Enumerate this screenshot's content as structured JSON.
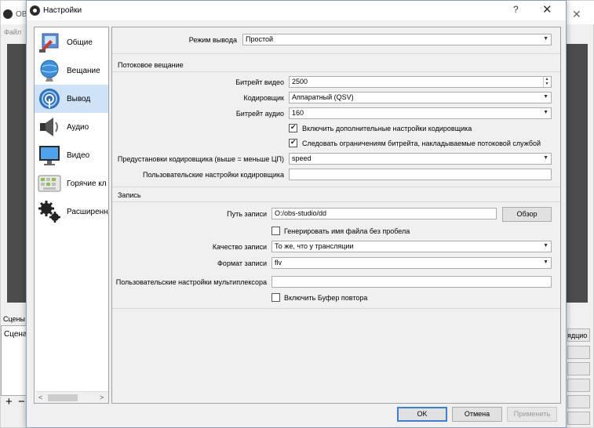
{
  "background_window": {
    "title": "OB",
    "menu_file": "Файл",
    "scenes_label": "Сцены",
    "scenes_item": "Сцена",
    "add_glyph": "+",
    "remove_glyph": "−",
    "right_button_text": "ядцио"
  },
  "dialog": {
    "title": "Настройки",
    "help_glyph": "?",
    "close_glyph": "✕"
  },
  "sidebar": {
    "items": [
      {
        "label": "Общие",
        "icon": "general-settings-icon",
        "selected": false
      },
      {
        "label": "Вещание",
        "icon": "broadcast-globe-icon",
        "selected": false
      },
      {
        "label": "Вывод",
        "icon": "output-signal-icon",
        "selected": true
      },
      {
        "label": "Аудио",
        "icon": "speaker-icon",
        "selected": false
      },
      {
        "label": "Видео",
        "icon": "monitor-icon",
        "selected": false
      },
      {
        "label": "Горячие кл",
        "icon": "keyboard-icon",
        "selected": false
      },
      {
        "label": "Расширенн",
        "icon": "gears-icon",
        "selected": false
      }
    ],
    "scroll_left": "<",
    "scroll_right": ">"
  },
  "output": {
    "mode_label": "Режим вывода",
    "mode_value": "Простой",
    "streaming": {
      "group_title": "Потоковое вещание",
      "video_bitrate_label": "Битрейт видео",
      "video_bitrate_value": "2500",
      "encoder_label": "Кодировщик",
      "encoder_value": "Аппаратный (QSV)",
      "audio_bitrate_label": "Битрейт аудио",
      "audio_bitrate_value": "160",
      "advanced_encoder_label": "Включить дополнительные настройки кодировщика",
      "advanced_encoder_checked": true,
      "enforce_bitrate_label": "Следовать ограничениям битрейта, накладываемые потоковой службой",
      "enforce_bitrate_checked": true,
      "preset_label": "Предустановки кодировщика (выше = меньше ЦП)",
      "preset_value": "speed",
      "custom_encoder_label": "Пользовательские настройки кодировщика",
      "custom_encoder_value": ""
    },
    "recording": {
      "group_title": "Запись",
      "path_label": "Путь записи",
      "path_value": "O:/obs-studio/dd",
      "browse_label": "Обзор",
      "no_space_label": "Генерировать имя файла без пробела",
      "no_space_checked": false,
      "quality_label": "Качество записи",
      "quality_value": "То же, что у трансляции",
      "format_label": "Формат записи",
      "format_value": "flv",
      "muxer_label": "Пользовательские настройки мультиплексора",
      "muxer_value": "",
      "replay_buffer_label": "Включить Буфер повтора",
      "replay_buffer_checked": false
    }
  },
  "buttons": {
    "ok": "OK",
    "cancel": "Отмена",
    "apply": "Применить"
  },
  "colors": {
    "selection": "#cfe3f7",
    "default_button_border": "#3c7fd6"
  }
}
